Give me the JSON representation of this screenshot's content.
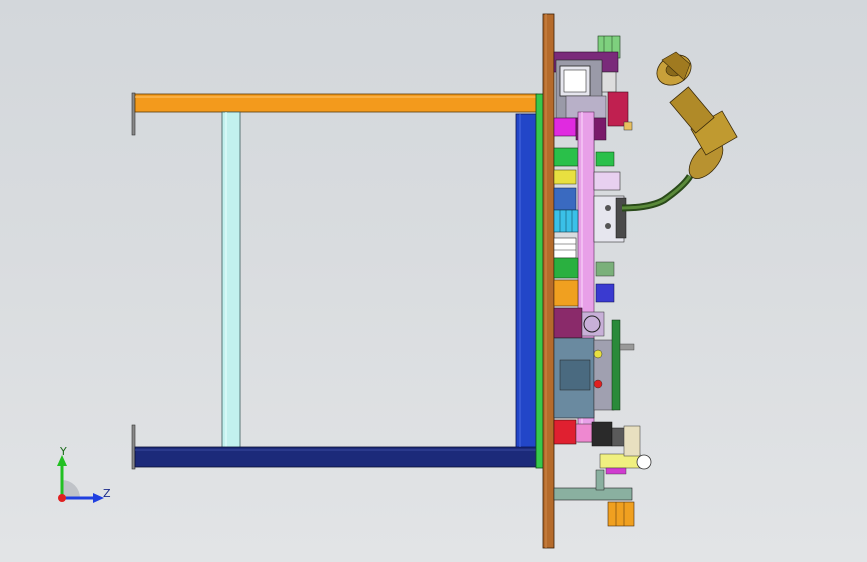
{
  "window": {
    "type": "cad-3d-viewport",
    "background": "#d8dbde"
  },
  "triad": {
    "y_label": "Y",
    "z_label": "Z",
    "x_color": "#e02020",
    "y_color": "#22c022",
    "z_color": "#2040e0"
  },
  "model": {
    "description_icon": "welding-fixture-assembly",
    "colors": {
      "frame_orange": "#f39a1c",
      "frame_navy": "#1c2a7a",
      "column_cyan": "#bff0ec",
      "base_plate": "#b06a2a",
      "green_plate": "#34c84a",
      "blue_panel": "#2244cc",
      "magenta": "#d03cd0",
      "robot_gold": "#b8902a",
      "robot_hose": "#3a6a2a"
    }
  }
}
